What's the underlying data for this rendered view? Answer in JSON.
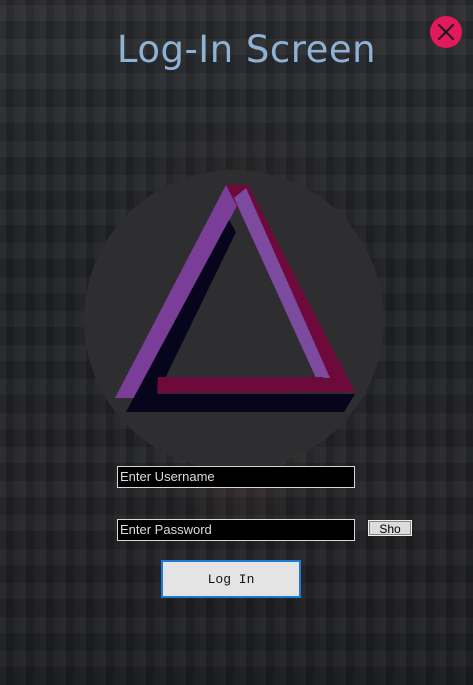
{
  "window": {
    "title": "Log-In Screen"
  },
  "close_icon": "close-icon",
  "logo": {
    "name": "impossible-triangle-logo",
    "colors": {
      "left": "#7b3e98",
      "right": "#6d0a3b",
      "shadow": "#06051c",
      "circle": "#2e2e31"
    }
  },
  "form": {
    "username_placeholder": "Enter Username",
    "password_placeholder": "Enter Password",
    "show_label": "Sho",
    "login_label": "Log In"
  },
  "colors": {
    "accent_close": "#e3195b",
    "title": "#8fb1d4",
    "login_border": "#1a7ad4"
  }
}
